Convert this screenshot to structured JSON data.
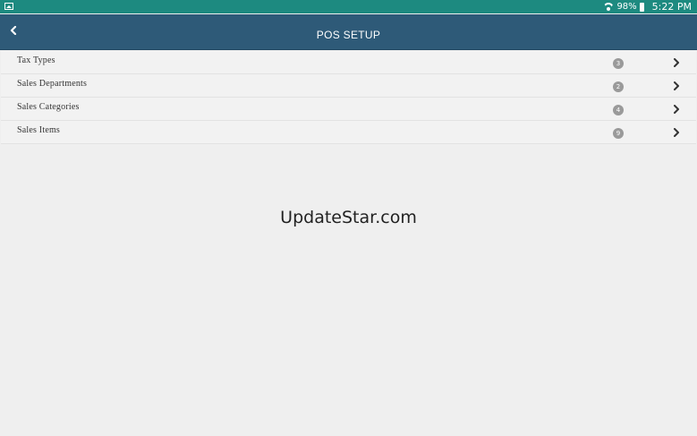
{
  "status_bar": {
    "battery": "98%",
    "time": "5:22 PM"
  },
  "header": {
    "title": "POS SETUP"
  },
  "menu": {
    "items": [
      {
        "label": "Tax Types",
        "count": "3"
      },
      {
        "label": "Sales Departments",
        "count": "2"
      },
      {
        "label": "Sales Categories",
        "count": "4"
      },
      {
        "label": "Sales Items",
        "count": "9"
      }
    ]
  },
  "watermark": "UpdateStar.com",
  "colors": {
    "status_bar": "#1d8a80",
    "header": "#2e5a78",
    "background": "#efefef",
    "badge": "#9a9a9a"
  }
}
